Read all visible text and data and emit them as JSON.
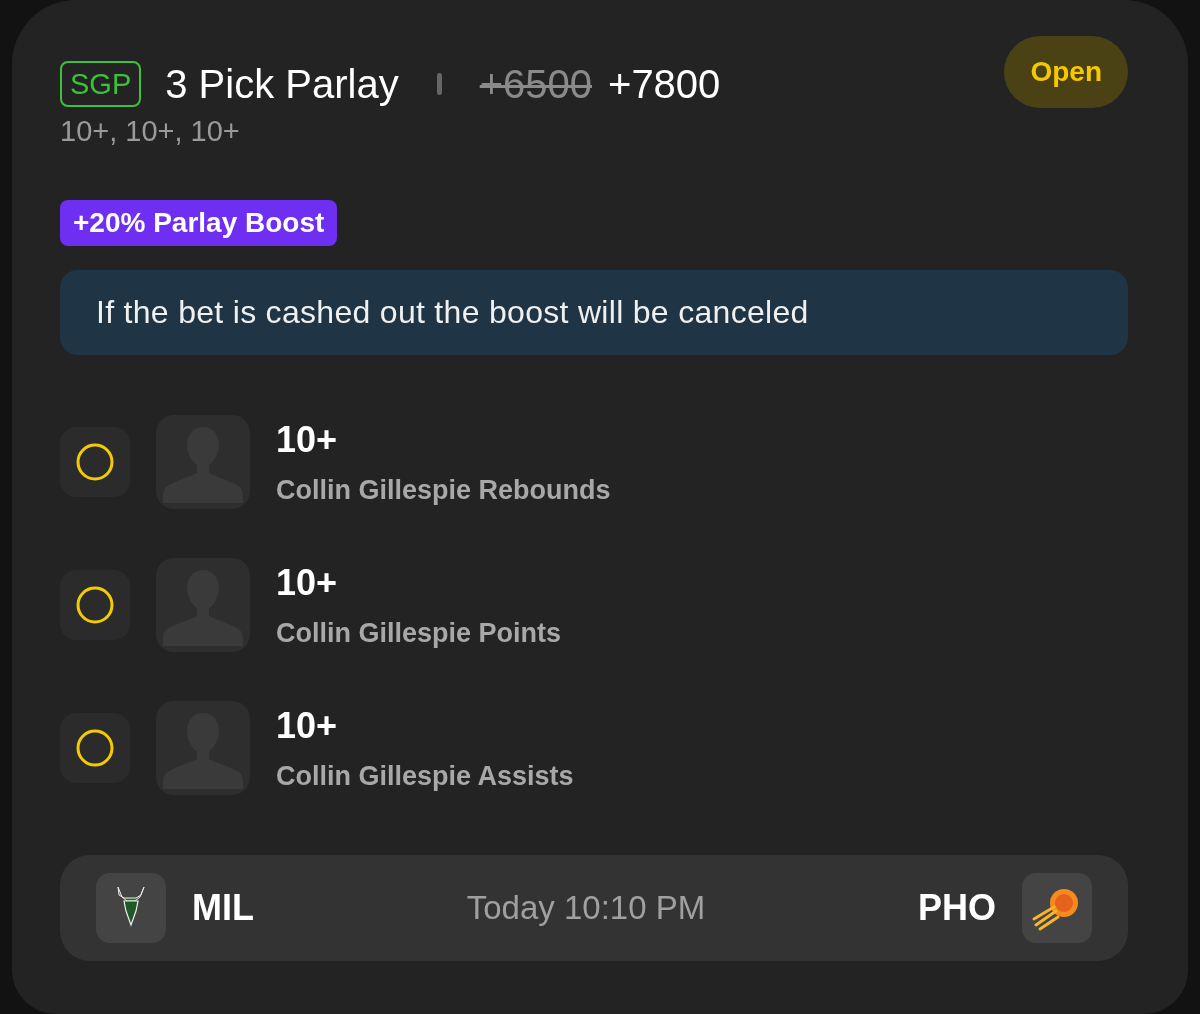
{
  "header": {
    "tag": "SGP",
    "title": "3 Pick Parlay",
    "old_odds": "+6500",
    "odds": "+7800",
    "status": "Open",
    "summary": "10+, 10+, 10+"
  },
  "boost": {
    "label": "+20% Parlay Boost"
  },
  "notice": "If the bet is cashed out the boost will be canceled",
  "legs": [
    {
      "line": "10+",
      "market": "Collin Gillespie Rebounds"
    },
    {
      "line": "10+",
      "market": "Collin Gillespie Points"
    },
    {
      "line": "10+",
      "market": "Collin Gillespie Assists"
    }
  ],
  "game": {
    "away": "MIL",
    "time": "Today 10:10 PM",
    "home": "PHO"
  }
}
